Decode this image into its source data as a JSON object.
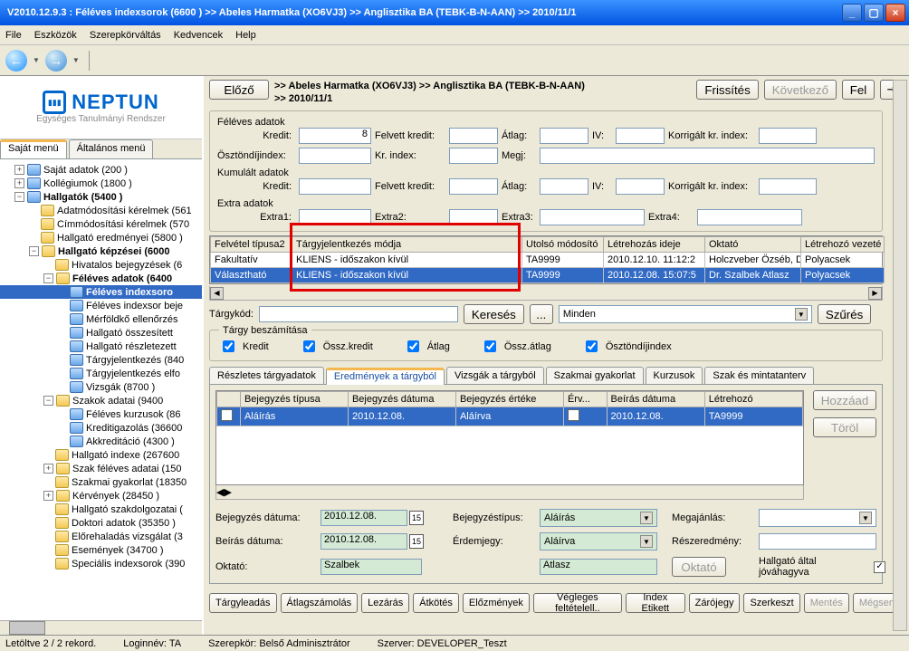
{
  "window": {
    "title": "V2010.12.9.3 : Féléves indexsorok (6600  )  >> Abeles Harmatka (XO6VJ3) >> Anglisztika BA (TEBK-B-N-AAN) >> 2010/11/1"
  },
  "menu": {
    "items": [
      "File",
      "Eszközök",
      "Szerepkörváltás",
      "Kedvencek",
      "Help"
    ]
  },
  "logo": {
    "brand": "NEPTUN",
    "sub": "Egységes Tanulmányi Rendszer"
  },
  "left_tabs": {
    "tab1": "Saját menü",
    "tab2": "Általános menü"
  },
  "tree": {
    "n1": "Saját adatok (200  )",
    "n2": "Kollégiumok (1800  )",
    "n3": "Hallgatók (5400  )",
    "n3_1": "Adatmódosítási kérelmek (561",
    "n3_2": "Címmódosítási kérelmek (570",
    "n3_3": "Hallgató eredményei (5800  )",
    "n3_4": "Hallgató képzései (6000",
    "n3_4_1": "Hivatalos bejegyzések (6",
    "n3_4_2": "Féléves adatok (6400",
    "n3_4_2_1": "Féléves indexsoro",
    "n3_4_2_2": "Féléves indexsor beje",
    "n3_4_2_3": "Mérföldkő ellenőrzés",
    "n3_4_2_4": "Hallgató összesített",
    "n3_4_2_5": "Hallgató részletezett",
    "n3_4_2_6": "Tárgyjelentkezés (840",
    "n3_4_2_7": "Tárgyjelentkezés elfo",
    "n3_4_2_8": "Vizsgák (8700  )",
    "n3_4_3": "Szakok adatai (9400",
    "n3_4_3_1": "Féléves kurzusok (86",
    "n3_4_3_2": "Kreditigazolás (36600",
    "n3_4_3_3": "Akkreditáció (4300  )",
    "n3_4_4": "Hallgató indexe (267600",
    "n3_4_5": "Szak féléves adatai (150",
    "n3_4_6": "Szakmai gyakorlat (18350",
    "n3_4_7": "Kérvények (28450  )",
    "n3_4_8": "Hallgató szakdolgozatai (",
    "n3_4_9": "Doktori adatok (35350  )",
    "n3_4_10": "Előrehaladás vizsgálat (3",
    "n3_4_11": "Események (34700  )",
    "n3_4_12": "Speciális indexsorok (390"
  },
  "header": {
    "prev": "Előző",
    "bc1": ">> Abeles Harmatka (XO6VJ3) >> Anglisztika BA (TEBK-B-N-AAN)",
    "bc2": ">> 2010/11/1",
    "refresh": "Frissítés",
    "next": "Következő",
    "up": "Fel"
  },
  "gbox": {
    "l1": "Féléves adatok",
    "l1a": "Kredit:",
    "v_kredit": "8",
    "l1b": "Felvett kredit:",
    "l1c": "Átlag:",
    "l1d": "IV:",
    "l1e": "Korrigált kr. index:",
    "l2": "Ösztöndíjindex:",
    "l2b": "Kr. index:",
    "l2c": "Megj:",
    "l3": "Kumulált adatok",
    "l3a": "Kredit:",
    "l3b": "Felvett kredit:",
    "l3c": "Átlag:",
    "l3d": "IV:",
    "l3e": "Korrigált kr. index:",
    "l4": "Extra adatok",
    "l4a": "Extra1:",
    "l4b": "Extra2:",
    "l4c": "Extra3:",
    "l4d": "Extra4:"
  },
  "grid": {
    "headers": [
      "Felvétel típusa2",
      "Tárgyjelentkezés módja",
      "Utolsó módosító",
      "Létrehozás ideje",
      "Oktató",
      "Létrehozó vezeté"
    ],
    "r1": {
      "c1": "Fakultatív",
      "c2": "KLIENS - időszakon kívül",
      "c3": "TA9999",
      "c4": "2010.12.10. 11:12:2",
      "c5": "Holczveber Özséb, D",
      "c6": "Polyacsek"
    },
    "r2": {
      "c1": "Választható",
      "c2": "KLIENS - időszakon kívül",
      "c3": "TA9999",
      "c4": "2010.12.08. 15:07:5",
      "c5": "Dr. Szalbek Atlasz",
      "c6": "Polyacsek"
    }
  },
  "filter": {
    "label": "Tárgykód:",
    "search": "Keresés",
    "ddot": "...",
    "scope": "Minden",
    "szures": "Szűrés"
  },
  "chk": {
    "legend": "Tárgy beszámítása",
    "c1": "Kredit",
    "c2": "Össz.kredit",
    "c3": "Átlag",
    "c4": "Össz.átlag",
    "c5": "Ösztöndíjindex"
  },
  "itabs": {
    "t1": "Részletes tárgyadatok",
    "t2": "Eredmények a tárgyból",
    "t3": "Vizsgák a tárgyból",
    "t4": "Szakmai gyakorlat",
    "t5": "Kurzusok",
    "t6": "Szak és mintatanterv"
  },
  "igrid": {
    "headers": [
      "",
      "Bejegyzés típusa",
      "Bejegyzés dátuma",
      "Bejegyzés értéke",
      "Érv...",
      "Beírás dátuma",
      "Létrehozó"
    ],
    "r1": {
      "c2": "Aláírás",
      "c3": "2010.12.08.",
      "c4": "Aláírva",
      "c6": "2010.12.08.",
      "c7": "TA9999"
    }
  },
  "sidebtn": {
    "add": "Hozzáad",
    "del": "Töröl"
  },
  "bform": {
    "l1": "Bejegyzés dátuma:",
    "v1": "2010.12.08.",
    "l2": "Bejegyzéstípus:",
    "v2": "Aláírás",
    "l3": "Megajánlás:",
    "l4": "Beírás dátuma:",
    "v4": "2010.12.08.",
    "l5": "Érdemjegy:",
    "v5": "Aláírva",
    "l6": "Részeredmény:",
    "l7": "Oktató:",
    "v7a": "Szalbek",
    "v7b": "Atlasz",
    "l8": "Oktató",
    "l9": "Hallgató által jóváhagyva"
  },
  "strip": {
    "b1": "Tárgyleadás",
    "b2": "Átlagszámolás",
    "b3": "Lezárás",
    "b4": "Átkötés",
    "b5": "Előzmények",
    "b6": "Végleges feltételell..",
    "b7": "Index Etikett",
    "b8": "Zárójegy",
    "b9": "Szerkeszt",
    "b10": "Mentés",
    "b11": "Mégsem"
  },
  "status": {
    "s1": "Letöltve 2 / 2 rekord.",
    "s2": "Loginnév: TA",
    "s3": "Szerepkör: Belső Adminisztrátor",
    "s4": "Szerver: DEVELOPER_Teszt"
  }
}
